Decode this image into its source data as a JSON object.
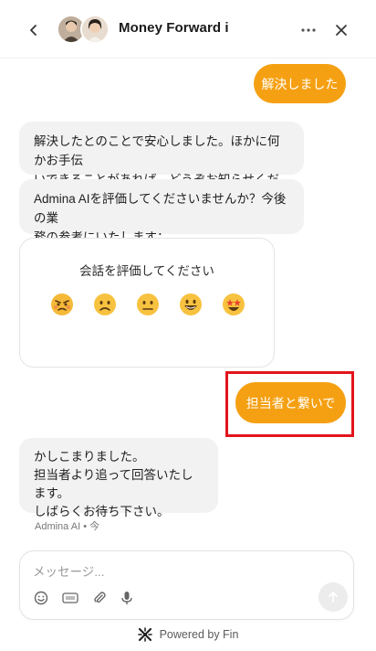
{
  "header": {
    "title": "Money Forward i"
  },
  "messages": {
    "user_1": "解決しました",
    "bot_1": "解決したとのことで安心しました。ほかに何かお手伝\nいできることがあれば、どうぞお知らせください。",
    "bot_2": "Admina AIを評価してくださいませんか？今後の業\n務の参考にいたします：",
    "user_2": "担当者と繋いで",
    "bot_3": "かしこまりました。\n担当者より追って回答いたします。\nしばらくお待ち下さい。"
  },
  "rating": {
    "title": "会話を評価してください",
    "options": [
      "angry",
      "frowning",
      "neutral",
      "smiling",
      "star-struck"
    ]
  },
  "meta": {
    "sender_time": "Admina AI • 今"
  },
  "composer": {
    "placeholder": "メッセージ..."
  },
  "footer": {
    "powered_by": "Powered by Fin"
  },
  "colors": {
    "accent": "#f5a012",
    "bot_bubble": "#f2f2f2",
    "highlight": "#e3141c"
  }
}
